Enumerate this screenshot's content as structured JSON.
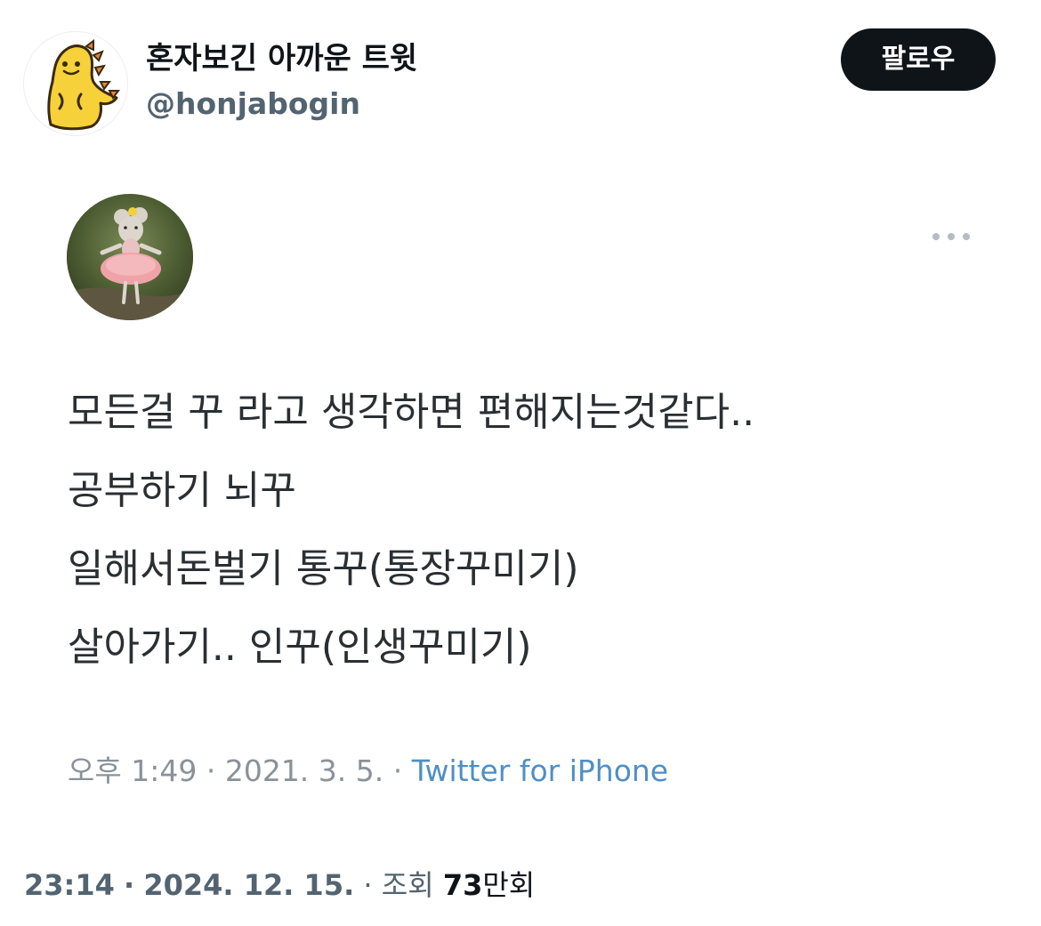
{
  "header": {
    "display_name": "혼자보긴 아까운 트윗",
    "handle": "@honjabogin",
    "follow_label": "팔로우",
    "avatar_icon": "yellow-dinosaur-avatar-icon"
  },
  "embedded_tweet": {
    "avatar_icon": "mouse-ballerina-avatar-icon",
    "more_icon": "more-options-icon",
    "text_lines": [
      "모든걸 꾸 라고 생각하면 편해지는것같다..",
      "공부하기 뇌꾸",
      "일해서돈벌기 통꾸(통장꾸미기)",
      "살아가기.. 인꾸(인생꾸미기)"
    ],
    "time": "오후 1:49",
    "date": "2021. 3. 5.",
    "separator": "·",
    "source": "Twitter for iPhone"
  },
  "footer": {
    "time": "23:14",
    "date": "2024. 12. 15.",
    "separator": "·",
    "views_label": "조회",
    "views_count": "73",
    "views_unit": "만회"
  },
  "colors": {
    "follow_button_bg": "#0f1419",
    "handle": "#536471",
    "source_link": "#4f8fc4",
    "dino_yellow": "#f6d13a"
  }
}
